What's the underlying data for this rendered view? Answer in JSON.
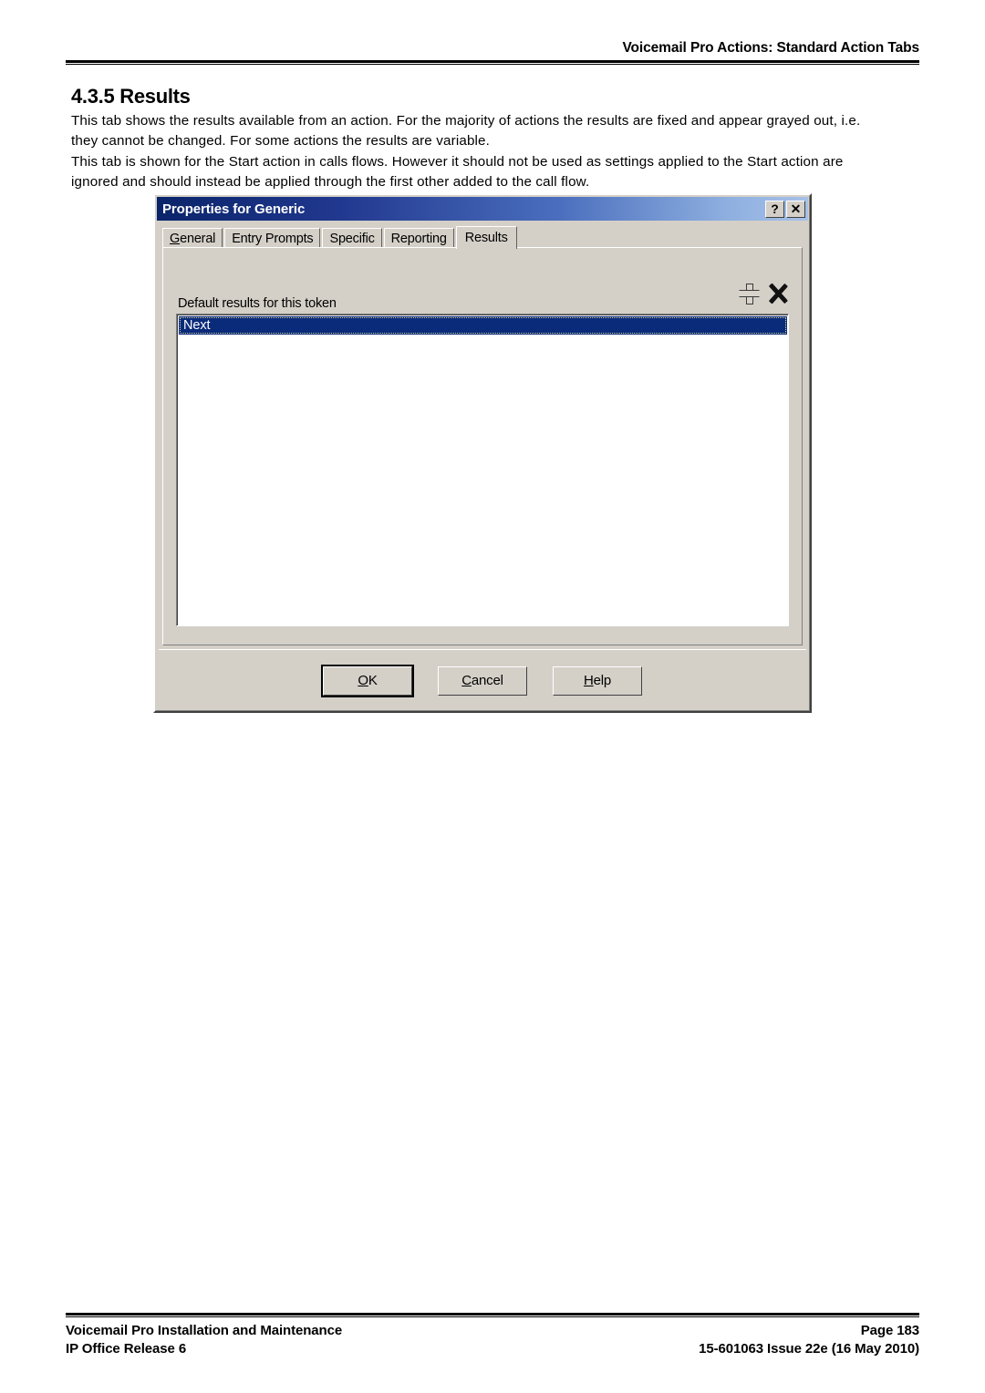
{
  "page": {
    "running_header": "Voicemail Pro Actions: Standard Action Tabs",
    "section_heading": "4.3.5 Results",
    "paragraph_1": "This tab shows the results available from an action. For the majority of actions the results are fixed and appear grayed out, i.e. they cannot be changed. For some actions the results are variable.",
    "paragraph_2": "This tab is shown for the Start action in calls flows. However it should not be used as settings applied to the Start action are ignored and should instead be applied through the first other added to the call flow."
  },
  "footer": {
    "left_line_1": "Voicemail Pro Installation and Maintenance",
    "left_line_2": "IP Office Release 6",
    "right_line_1": "Page 183",
    "right_line_2": "15-601063 Issue 22e (16 May 2010)"
  },
  "dialog": {
    "title": "Properties for Generic",
    "title_buttons": {
      "help": "?",
      "close": "✕"
    },
    "tabs": [
      {
        "label": "General",
        "mnemonic": "G",
        "active": false
      },
      {
        "label": "Entry Prompts",
        "mnemonic": "",
        "active": false
      },
      {
        "label": "Specific",
        "mnemonic": "",
        "active": false
      },
      {
        "label": "Reporting",
        "mnemonic": "",
        "active": false
      },
      {
        "label": "Results",
        "mnemonic": "",
        "active": true
      }
    ],
    "results_tab": {
      "field_label": "Default results for this token",
      "toolbar_icons": [
        {
          "name": "add-icon",
          "glyph": "+"
        },
        {
          "name": "delete-icon",
          "glyph": "✕"
        }
      ],
      "list_items": [
        {
          "label": "Next",
          "selected": true
        }
      ]
    },
    "buttons": [
      {
        "label": "OK",
        "mnemonic": "O",
        "default": true
      },
      {
        "label": "Cancel",
        "mnemonic": "C",
        "default": false
      },
      {
        "label": "Help",
        "mnemonic": "H",
        "default": false
      }
    ],
    "colors": {
      "title_gradient_start": "#0a246a",
      "title_gradient_end": "#a6c0e8",
      "dialog_face": "#d4d0c8",
      "selection": "#0a2a7a"
    }
  }
}
